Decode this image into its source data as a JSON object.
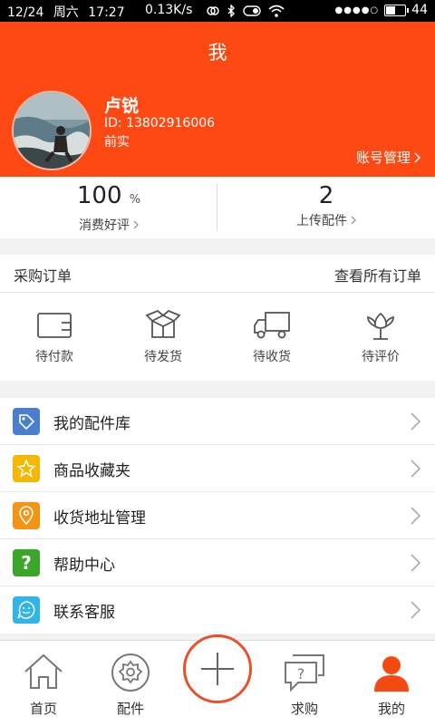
{
  "statusbar": {
    "date": "12/24",
    "weekday": "周六",
    "time": "17:27",
    "speed": "0.13K/s",
    "signal_dots": "●●●●○",
    "battery_level": 0.44,
    "battery_text": "44"
  },
  "header": {
    "title": "我",
    "user_name": "卢锐",
    "user_id": "ID: 13802916006",
    "user_level": "前实",
    "account_label": "账号管理"
  },
  "stats": [
    {
      "value": "100",
      "unit": "%",
      "label": "消费好评"
    },
    {
      "value": "2",
      "unit": "",
      "label": "上传配件"
    }
  ],
  "orders": {
    "title": "采购订单",
    "view_all": "查看所有订单",
    "items": [
      {
        "label": "待付款",
        "icon": "wallet-icon"
      },
      {
        "label": "待发货",
        "icon": "package-icon"
      },
      {
        "label": "待收货",
        "icon": "truck-icon"
      },
      {
        "label": "待评价",
        "icon": "flower-icon"
      }
    ]
  },
  "menu": [
    {
      "label": "我的配件库",
      "icon": "tag-icon",
      "color": "#4a7fd0"
    },
    {
      "label": "商品收藏夹",
      "icon": "star-icon",
      "color": "#f5b800"
    },
    {
      "label": "收货地址管理",
      "icon": "location-pin-icon",
      "color": "#f59312"
    },
    {
      "label": "帮助中心",
      "icon": "question-icon",
      "color": "#3aa62a"
    },
    {
      "label": "联系客服",
      "icon": "smiley-chat-icon",
      "color": "#2fb5e8"
    }
  ],
  "tabbar": {
    "items": [
      {
        "label": "首页",
        "icon": "home-icon"
      },
      {
        "label": "配件",
        "icon": "gear-icon"
      },
      {
        "label": "",
        "icon": "plus-icon"
      },
      {
        "label": "求购",
        "icon": "question-bubble-icon"
      },
      {
        "label": "我的",
        "icon": "user-icon"
      }
    ],
    "active": "我的"
  },
  "colors": {
    "brand": "#fd4a14",
    "plus_ring": "#e8522a"
  }
}
